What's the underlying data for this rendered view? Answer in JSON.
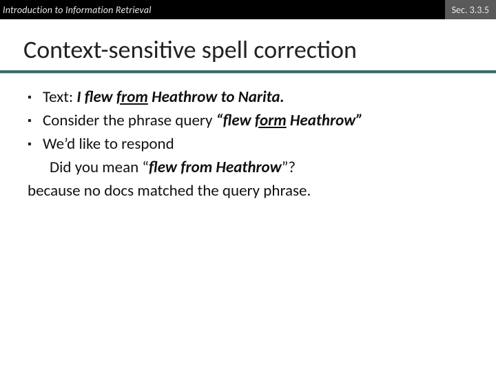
{
  "header": {
    "course": "Introduction to Information Retrieval",
    "section": "Sec. 3.3.5"
  },
  "title": "Context-sensitive spell correction",
  "bullets": {
    "b1_pre": "Text: ",
    "b1_i1": "I flew ",
    "b1_u": "from",
    "b1_i2": " Heathrow to Narita.",
    "b2_pre": "Consider the phrase query ",
    "b2_i1": "“flew ",
    "b2_u": "form",
    "b2_i2": " Heathrow”",
    "b3": "We’d like to respond"
  },
  "response": {
    "dym_pre": "Did you mean “",
    "dym_i": "flew from Heathrow",
    "dym_post": "”?",
    "reason": "because no docs matched the query phrase."
  }
}
